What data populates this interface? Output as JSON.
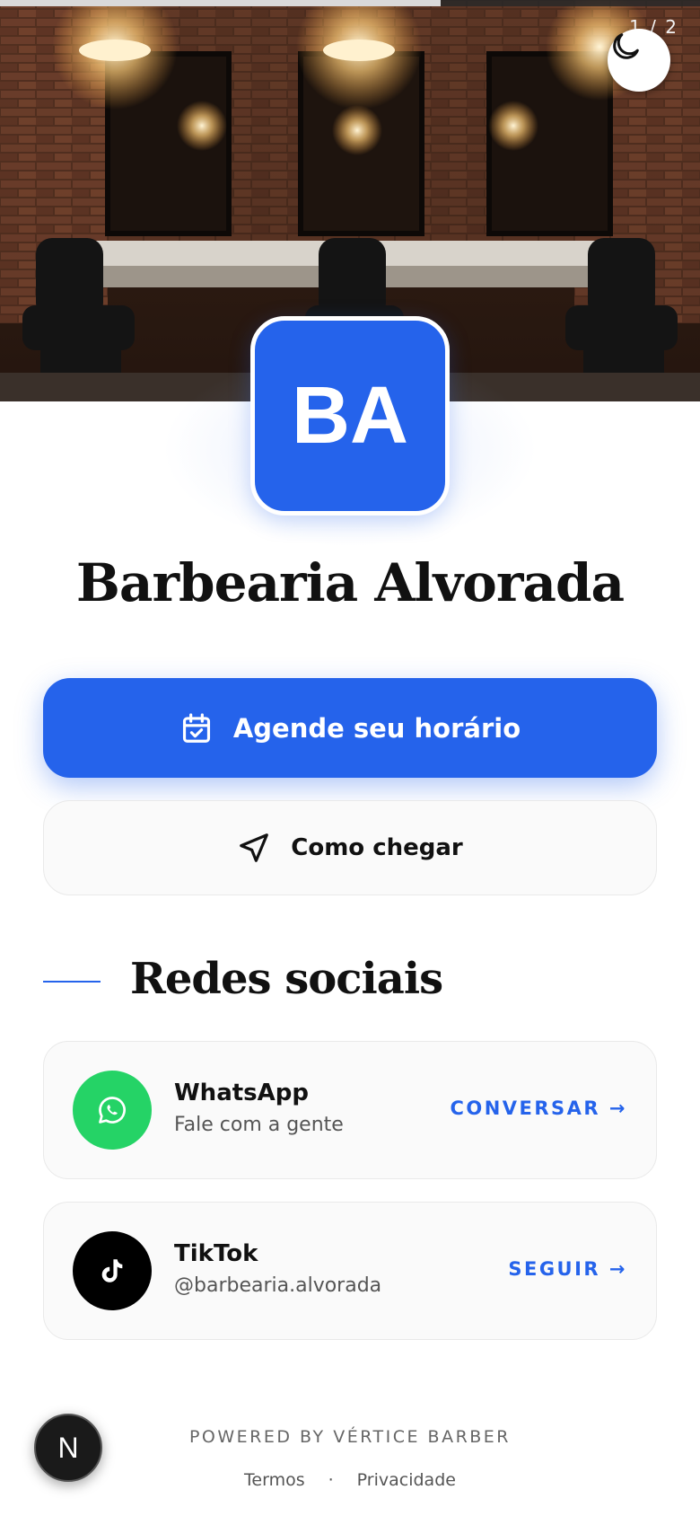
{
  "hero": {
    "counter": "1 / 2",
    "progress_fraction": 0.63,
    "theme_toggle_icon": "moon-icon"
  },
  "business": {
    "initials": "BA",
    "name": "Barbearia Alvorada",
    "accent_color": "#2563eb"
  },
  "actions": {
    "primary_label": "Agende seu horário",
    "primary_icon": "calendar-check-icon",
    "secondary_label": "Como chegar",
    "secondary_icon": "navigation-arrow-icon"
  },
  "social": {
    "section_title": "Redes sociais",
    "items": [
      {
        "name": "WhatsApp",
        "subtitle": "Fale com a gente",
        "action": "CONVERSAR →",
        "icon": "whatsapp-icon",
        "color": "#25d366"
      },
      {
        "name": "TikTok",
        "subtitle": "@barbearia.alvorada",
        "action": "SEGUIR →",
        "icon": "tiktok-icon",
        "color": "#000000"
      }
    ]
  },
  "footer": {
    "powered_by": "POWERED BY VÉRTICE BARBER",
    "separator": "·",
    "links": [
      "Termos",
      "Privacidade"
    ],
    "badge_letter": "N"
  }
}
